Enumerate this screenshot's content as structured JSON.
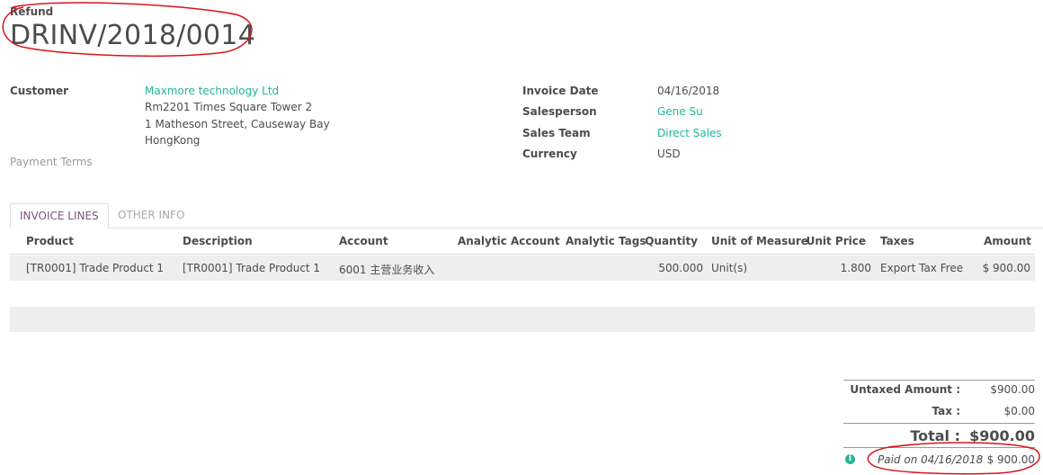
{
  "header": {
    "type_label": "Refund",
    "number": "DRINV/2018/0014"
  },
  "left_fields": {
    "customer_label": "Customer",
    "customer_name": "Maxmore technology Ltd",
    "address_line1": "Rm2201 Times Square Tower 2",
    "address_line2": "1 Matheson Street, Causeway Bay",
    "address_line3": "HongKong",
    "payment_terms_label": "Payment Terms"
  },
  "right_fields": {
    "invoice_date_label": "Invoice Date",
    "invoice_date": "04/16/2018",
    "salesperson_label": "Salesperson",
    "salesperson": "Gene Su",
    "sales_team_label": "Sales Team",
    "sales_team": "Direct Sales",
    "currency_label": "Currency",
    "currency": "USD"
  },
  "tabs": [
    "INVOICE LINES",
    "OTHER INFO"
  ],
  "table": {
    "columns": [
      "Product",
      "Description",
      "Account",
      "Analytic Account",
      "Analytic Tags",
      "Quantity",
      "Unit of Measure",
      "Unit Price",
      "Taxes",
      "Amount"
    ],
    "rows": [
      {
        "product": "[TR0001] Trade Product 1",
        "description": "[TR0001] Trade Product 1",
        "account": "6001 主营业务收入",
        "analytic_account": "",
        "analytic_tags": "",
        "quantity": "500.000",
        "uom": "Unit(s)",
        "unit_price": "1.800",
        "taxes": "Export Tax Free",
        "amount": "$ 900.00"
      }
    ]
  },
  "totals": {
    "untaxed_label": "Untaxed Amount :",
    "untaxed_value": "$900.00",
    "tax_label": "Tax :",
    "tax_value": "$0.00",
    "total_label": "Total :",
    "total_value": "$900.00"
  },
  "payment": {
    "info_icon": "info-circle-icon",
    "paid_text": "Paid on 04/16/2018",
    "paid_amount": "$ 900.00"
  },
  "colors": {
    "link": "#21b799",
    "active_tab": "#7c5477",
    "annotation": "#d9141b"
  }
}
